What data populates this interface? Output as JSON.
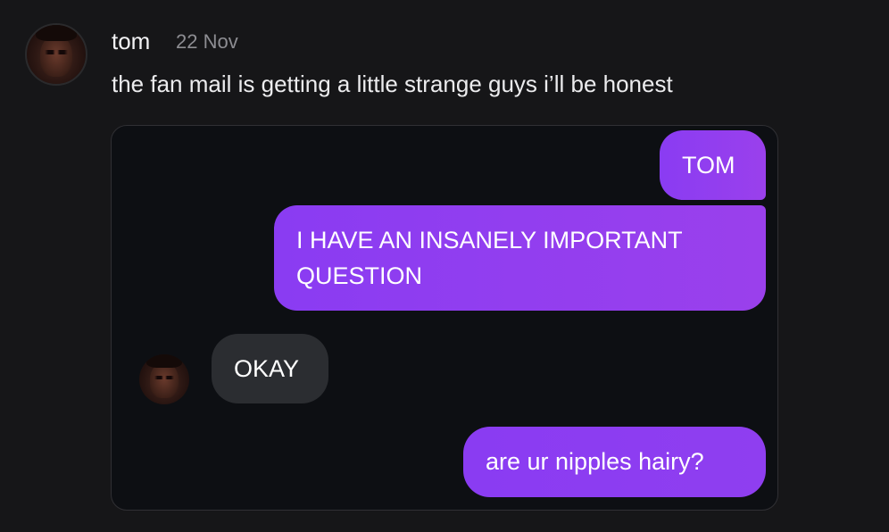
{
  "post": {
    "author": "tom",
    "date": "22 Nov",
    "text": "the fan mail is getting a little strange guys i’ll be honest",
    "avatar_icon": "user-avatar"
  },
  "embed": {
    "messages": [
      {
        "id": "m1",
        "side": "sent",
        "lines": [
          "TOM"
        ]
      },
      {
        "id": "m2",
        "side": "sent",
        "lines": [
          "I HAVE AN INSANELY IMPORTANT",
          "QUESTION"
        ]
      },
      {
        "id": "m3",
        "side": "received",
        "lines": [
          "OKAY"
        ]
      },
      {
        "id": "m4",
        "side": "sent",
        "lines": [
          "are ur nipples hairy?"
        ]
      }
    ],
    "reply_avatar_icon": "user-avatar"
  },
  "colors": {
    "background": "#161618",
    "embed_background": "#0d0f13",
    "sent_bubble": "#8a3cf2",
    "received_bubble": "#2b2d31",
    "date_text": "#8d8d92"
  }
}
